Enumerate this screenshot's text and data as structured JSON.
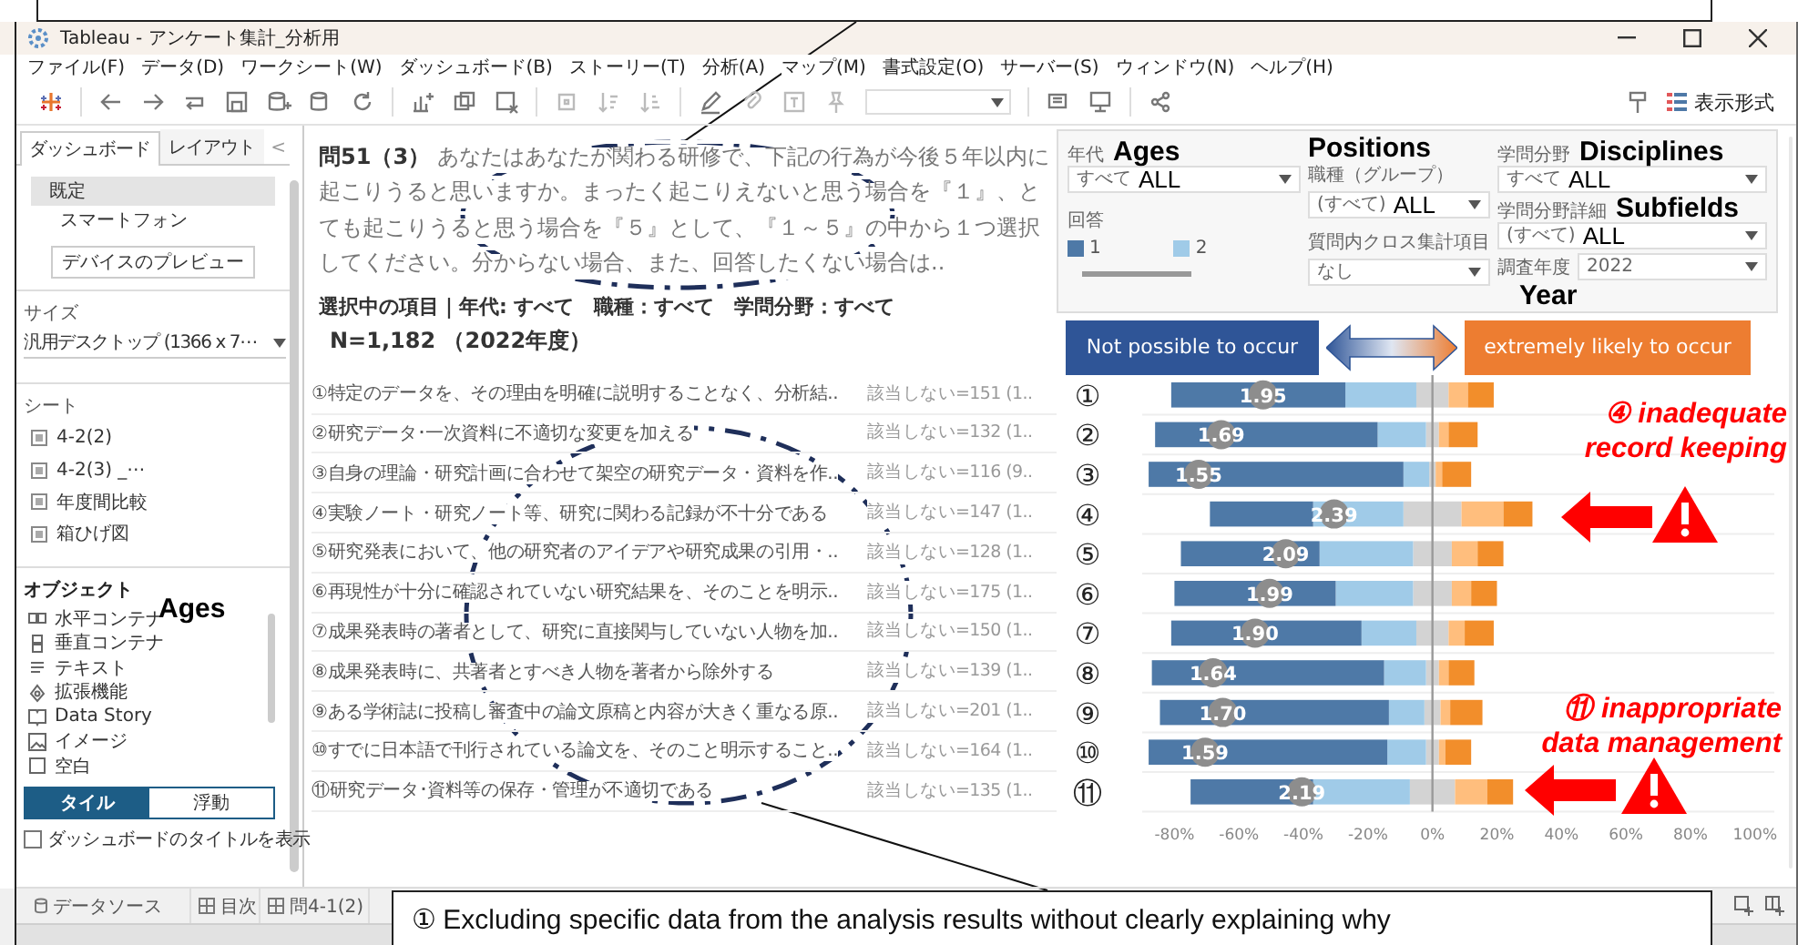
{
  "window": {
    "title": "Tableau - アンケート集計_分析用"
  },
  "menu": [
    "ファイル(F)",
    "データ(D)",
    "ワークシート(W)",
    "ダッシュボード(B)",
    "ストーリー(T)",
    "分析(A)",
    "マップ(M)",
    "書式設定(O)",
    "サーバー(S)",
    "ウィンドウ(N)",
    "ヘルプ(H)"
  ],
  "toolbar": {
    "format_button": "表示形式"
  },
  "left_panel": {
    "tabs": [
      {
        "label": "ダッシュボード",
        "selected": true
      },
      {
        "label": "レイアウト",
        "selected": false
      }
    ],
    "collapse": "<",
    "devices": [
      {
        "label": "既定",
        "selected": true
      },
      {
        "label": "スマートフォン",
        "selected": false
      }
    ],
    "preview_button": "デバイスのプレビュー",
    "size": {
      "title": "サイズ",
      "value": "汎用デスクトップ (1366 x 7⋯"
    },
    "sheets": {
      "title": "シート",
      "items": [
        "4-2(2)",
        "4-2(3) _⋯",
        "年度間比較",
        "箱ひげ図"
      ]
    },
    "objects": {
      "title": "オブジェクト",
      "annotation": "Ages",
      "items": [
        "水平コンテナ",
        "垂直コンテナ",
        "テキスト",
        "拡張機能",
        "Data Story",
        "イメージ",
        "空白"
      ]
    },
    "layout_mode": [
      {
        "label": "タイル",
        "selected": true
      },
      {
        "label": "浮動",
        "selected": false
      }
    ],
    "show_title": {
      "label": "ダッシュボードのタイトルを表示",
      "checked": false
    }
  },
  "question": {
    "text": "**問51（3）** あなたはあなたが関わる研修で、下記の行為が今後５年以内に起こりうると思いますか。まったく起こりえないと思う場合を『１』、とても起こりうると思う場合を『５』として、『１～５』の中から１つ選択してください。分からない場合、また、回答したくない場合は..",
    "selection": "選択中の項目｜年代: すべて　職種：すべて　学問分野：すべて",
    "sample": "N=1,182 （2022年度）"
  },
  "items": [
    {
      "text": "①特定のデータを、その理由を明確に説明することなく、分析結..",
      "count": "該当しない=151 (1.."
    },
    {
      "text": "②研究データ･一次資料に不適切な変更を加える",
      "count": "該当しない=132 (1.."
    },
    {
      "text": "③自身の理論・研究計画に合わせて架空の研究データ・資料を作..",
      "count": "該当しない=116 (9.."
    },
    {
      "text": "④実験ノート・研究ノート等、研究に関わる記録が不十分である",
      "count": "該当しない=147 (1.."
    },
    {
      "text": "⑤研究発表において、他の研究者のアイデアや研究成果の引用・..",
      "count": "該当しない=128 (1.."
    },
    {
      "text": "⑥再現性が十分に確認されていない研究結果を、そのことを明示..",
      "count": "該当しない=175 (1.."
    },
    {
      "text": "⑦成果発表時の著者として、研究に直接関与していない人物を加..",
      "count": "該当しない=150 (1.."
    },
    {
      "text": "⑧成果発表時に、共著者とすべき人物を著者から除外する",
      "count": "該当しない=139 (1.."
    },
    {
      "text": "⑨ある学術誌に投稿し審査中の論文原稿と内容が大きく重なる原..",
      "count": "該当しない=201 (1.."
    },
    {
      "text": "⑩すでに日本語で刊行されている論文を、そのこと明示すること..",
      "count": "該当しない=164 (1.."
    },
    {
      "text": "⑪研究データ･資料等の保存・管理が不適切である",
      "count": "該当しない=135 (1.."
    }
  ],
  "filters": {
    "age": {
      "label": "年代",
      "annotation": "Ages",
      "value": "すべて",
      "annotation_value": "ALL"
    },
    "answer_legend": {
      "title": "回答",
      "items": [
        {
          "label": "1",
          "color": "#4e79a7"
        },
        {
          "label": "2",
          "color": "#a0cbe8"
        }
      ]
    },
    "position": {
      "label": "職種（グループ）",
      "annotation": "Positions",
      "value": "(すべて)",
      "annotation_value": "ALL"
    },
    "cross_tab": {
      "label": "質問内クロス集計項目",
      "value": "なし"
    },
    "discipline": {
      "label": "学問分野",
      "annotation": "Disciplines",
      "value": "すべて",
      "annotation_value": "ALL"
    },
    "subfield": {
      "label": "学問分野詳細",
      "annotation": "Subfields",
      "value": "(すべて)",
      "annotation_value": "ALL"
    },
    "year": {
      "label": "調査年度",
      "value": "2022",
      "annotation": "Year"
    }
  },
  "scale": {
    "left": "Not possible to occur",
    "right": "extremely likely to occur"
  },
  "chart_data": {
    "type": "bar",
    "orientation": "horizontal",
    "stacked": true,
    "categories": [
      "①",
      "②",
      "③",
      "④",
      "⑤",
      "⑥",
      "⑦",
      "⑧",
      "⑨",
      "⑩",
      "⑪"
    ],
    "series": [
      {
        "color": "#d3d3d3",
        "values": [
          -0.05,
          -0.02,
          -0.01,
          -0.09,
          -0.06,
          -0.06,
          -0.05,
          -0.02,
          -0.025,
          -0.02,
          -0.07
        ]
      },
      {
        "color": "#a0cbe8",
        "values": [
          -0.22,
          -0.15,
          -0.08,
          -0.28,
          -0.29,
          -0.24,
          -0.17,
          -0.13,
          -0.11,
          -0.12,
          -0.3
        ]
      },
      {
        "color": "#4e79a7",
        "values": [
          -0.54,
          -0.69,
          -0.79,
          -0.32,
          -0.43,
          -0.5,
          -0.59,
          -0.72,
          -0.71,
          -0.74,
          -0.38
        ]
      },
      {
        "color": "#d3d3d3",
        "values": [
          0.05,
          0.02,
          0.01,
          0.09,
          0.06,
          0.06,
          0.05,
          0.02,
          0.025,
          0.02,
          0.07
        ]
      },
      {
        "color": "#ffbe7d",
        "values": [
          0.06,
          0.03,
          0.02,
          0.13,
          0.08,
          0.06,
          0.05,
          0.03,
          0.03,
          0.02,
          0.1
        ]
      },
      {
        "color": "#f28e2b",
        "values": [
          0.08,
          0.09,
          0.09,
          0.09,
          0.08,
          0.08,
          0.09,
          0.08,
          0.1,
          0.08,
          0.08
        ]
      }
    ],
    "xlim": [
      -0.9,
      1.06
    ],
    "xticks": [
      {
        "value": -0.8,
        "label": "-80%"
      },
      {
        "value": -0.6,
        "label": "-60%"
      },
      {
        "value": -0.4,
        "label": "-40%"
      },
      {
        "value": -0.2,
        "label": "-20%"
      },
      {
        "value": 0,
        "label": "0%"
      },
      {
        "value": 0.2,
        "label": "20%"
      },
      {
        "value": 0.4,
        "label": "40%"
      },
      {
        "value": 0.6,
        "label": "60%"
      },
      {
        "value": 0.8,
        "label": "80%"
      },
      {
        "value": 1,
        "label": "100%"
      }
    ],
    "value_labels": [
      "1.95",
      "1.69",
      "1.55",
      "2.39",
      "2.09",
      "1.99",
      "1.90",
      "1.64",
      "1.70",
      "1.59",
      "2.19"
    ]
  },
  "callouts": [
    "④ inadequate record keeping",
    "⑪ inappropriate data management"
  ],
  "bottom_tabs": [
    "データソース",
    "目次",
    "問4-1(2)"
  ],
  "caption": "① Excluding specific data from the analysis results without clearly explaining why"
}
